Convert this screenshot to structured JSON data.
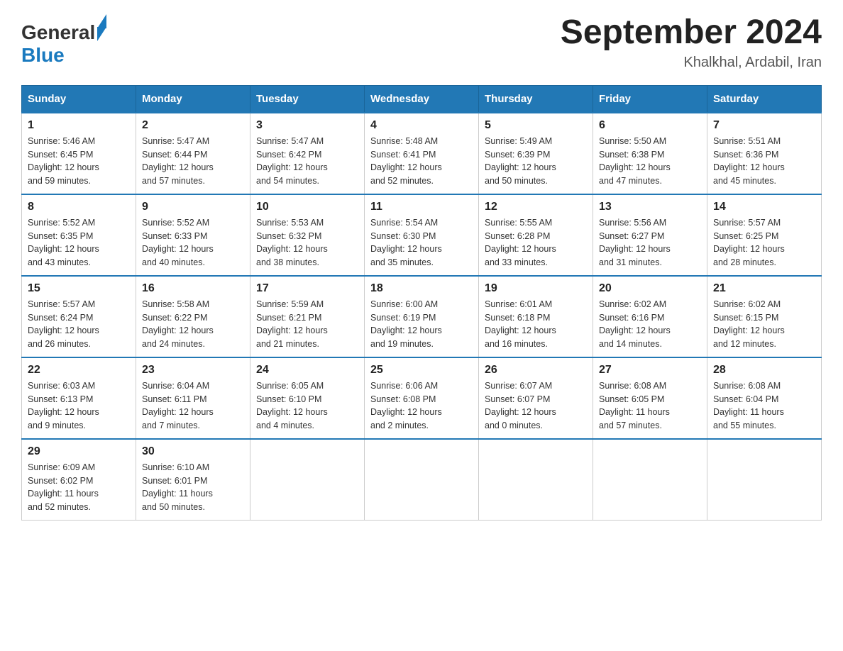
{
  "logo": {
    "text1": "General",
    "text2": "Blue"
  },
  "title": "September 2024",
  "location": "Khalkhal, Ardabil, Iran",
  "days_header": [
    "Sunday",
    "Monday",
    "Tuesday",
    "Wednesday",
    "Thursday",
    "Friday",
    "Saturday"
  ],
  "weeks": [
    [
      {
        "day": "1",
        "info": "Sunrise: 5:46 AM\nSunset: 6:45 PM\nDaylight: 12 hours\nand 59 minutes."
      },
      {
        "day": "2",
        "info": "Sunrise: 5:47 AM\nSunset: 6:44 PM\nDaylight: 12 hours\nand 57 minutes."
      },
      {
        "day": "3",
        "info": "Sunrise: 5:47 AM\nSunset: 6:42 PM\nDaylight: 12 hours\nand 54 minutes."
      },
      {
        "day": "4",
        "info": "Sunrise: 5:48 AM\nSunset: 6:41 PM\nDaylight: 12 hours\nand 52 minutes."
      },
      {
        "day": "5",
        "info": "Sunrise: 5:49 AM\nSunset: 6:39 PM\nDaylight: 12 hours\nand 50 minutes."
      },
      {
        "day": "6",
        "info": "Sunrise: 5:50 AM\nSunset: 6:38 PM\nDaylight: 12 hours\nand 47 minutes."
      },
      {
        "day": "7",
        "info": "Sunrise: 5:51 AM\nSunset: 6:36 PM\nDaylight: 12 hours\nand 45 minutes."
      }
    ],
    [
      {
        "day": "8",
        "info": "Sunrise: 5:52 AM\nSunset: 6:35 PM\nDaylight: 12 hours\nand 43 minutes."
      },
      {
        "day": "9",
        "info": "Sunrise: 5:52 AM\nSunset: 6:33 PM\nDaylight: 12 hours\nand 40 minutes."
      },
      {
        "day": "10",
        "info": "Sunrise: 5:53 AM\nSunset: 6:32 PM\nDaylight: 12 hours\nand 38 minutes."
      },
      {
        "day": "11",
        "info": "Sunrise: 5:54 AM\nSunset: 6:30 PM\nDaylight: 12 hours\nand 35 minutes."
      },
      {
        "day": "12",
        "info": "Sunrise: 5:55 AM\nSunset: 6:28 PM\nDaylight: 12 hours\nand 33 minutes."
      },
      {
        "day": "13",
        "info": "Sunrise: 5:56 AM\nSunset: 6:27 PM\nDaylight: 12 hours\nand 31 minutes."
      },
      {
        "day": "14",
        "info": "Sunrise: 5:57 AM\nSunset: 6:25 PM\nDaylight: 12 hours\nand 28 minutes."
      }
    ],
    [
      {
        "day": "15",
        "info": "Sunrise: 5:57 AM\nSunset: 6:24 PM\nDaylight: 12 hours\nand 26 minutes."
      },
      {
        "day": "16",
        "info": "Sunrise: 5:58 AM\nSunset: 6:22 PM\nDaylight: 12 hours\nand 24 minutes."
      },
      {
        "day": "17",
        "info": "Sunrise: 5:59 AM\nSunset: 6:21 PM\nDaylight: 12 hours\nand 21 minutes."
      },
      {
        "day": "18",
        "info": "Sunrise: 6:00 AM\nSunset: 6:19 PM\nDaylight: 12 hours\nand 19 minutes."
      },
      {
        "day": "19",
        "info": "Sunrise: 6:01 AM\nSunset: 6:18 PM\nDaylight: 12 hours\nand 16 minutes."
      },
      {
        "day": "20",
        "info": "Sunrise: 6:02 AM\nSunset: 6:16 PM\nDaylight: 12 hours\nand 14 minutes."
      },
      {
        "day": "21",
        "info": "Sunrise: 6:02 AM\nSunset: 6:15 PM\nDaylight: 12 hours\nand 12 minutes."
      }
    ],
    [
      {
        "day": "22",
        "info": "Sunrise: 6:03 AM\nSunset: 6:13 PM\nDaylight: 12 hours\nand 9 minutes."
      },
      {
        "day": "23",
        "info": "Sunrise: 6:04 AM\nSunset: 6:11 PM\nDaylight: 12 hours\nand 7 minutes."
      },
      {
        "day": "24",
        "info": "Sunrise: 6:05 AM\nSunset: 6:10 PM\nDaylight: 12 hours\nand 4 minutes."
      },
      {
        "day": "25",
        "info": "Sunrise: 6:06 AM\nSunset: 6:08 PM\nDaylight: 12 hours\nand 2 minutes."
      },
      {
        "day": "26",
        "info": "Sunrise: 6:07 AM\nSunset: 6:07 PM\nDaylight: 12 hours\nand 0 minutes."
      },
      {
        "day": "27",
        "info": "Sunrise: 6:08 AM\nSunset: 6:05 PM\nDaylight: 11 hours\nand 57 minutes."
      },
      {
        "day": "28",
        "info": "Sunrise: 6:08 AM\nSunset: 6:04 PM\nDaylight: 11 hours\nand 55 minutes."
      }
    ],
    [
      {
        "day": "29",
        "info": "Sunrise: 6:09 AM\nSunset: 6:02 PM\nDaylight: 11 hours\nand 52 minutes."
      },
      {
        "day": "30",
        "info": "Sunrise: 6:10 AM\nSunset: 6:01 PM\nDaylight: 11 hours\nand 50 minutes."
      },
      {
        "day": "",
        "info": ""
      },
      {
        "day": "",
        "info": ""
      },
      {
        "day": "",
        "info": ""
      },
      {
        "day": "",
        "info": ""
      },
      {
        "day": "",
        "info": ""
      }
    ]
  ]
}
